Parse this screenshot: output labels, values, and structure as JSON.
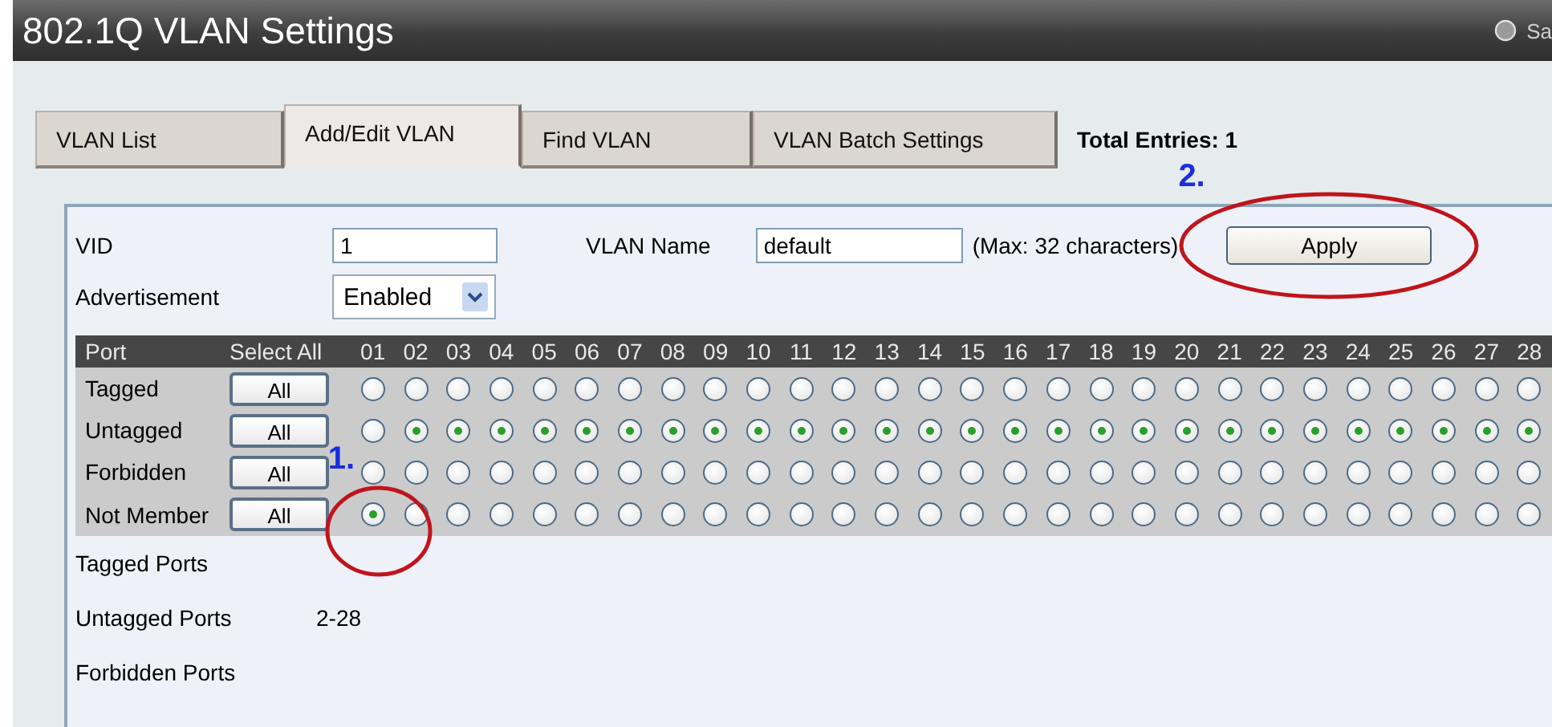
{
  "window": {
    "title": "802.1Q VLAN Settings",
    "corner_text": "Sa"
  },
  "tabs": [
    {
      "label": "VLAN List",
      "selected": false
    },
    {
      "label": "Add/Edit VLAN",
      "selected": true
    },
    {
      "label": "Find VLAN",
      "selected": false
    },
    {
      "label": "VLAN Batch Settings",
      "selected": false
    }
  ],
  "total_entries": "Total Entries: 1",
  "form": {
    "vid_label": "VID",
    "vid_value": "1",
    "name_label": "VLAN Name",
    "name_value": "default",
    "name_hint": "(Max: 32 characters)",
    "apply": "Apply",
    "advertisement_label": "Advertisement",
    "advertisement_value": "Enabled"
  },
  "ports": {
    "header": "Port",
    "select_all": "Select All",
    "numbers": [
      "01",
      "02",
      "03",
      "04",
      "05",
      "06",
      "07",
      "08",
      "09",
      "10",
      "11",
      "12",
      "13",
      "14",
      "15",
      "16",
      "17",
      "18",
      "19",
      "20",
      "21",
      "22",
      "23",
      "24",
      "25",
      "26",
      "27",
      "28"
    ],
    "rows": [
      {
        "label": "Tagged",
        "button": "All",
        "radios": [
          {
            "selected": false
          },
          {
            "selected": false
          },
          {
            "selected": false
          },
          {
            "selected": false
          },
          {
            "selected": false
          },
          {
            "selected": false
          },
          {
            "selected": false
          },
          {
            "selected": false
          },
          {
            "selected": false
          },
          {
            "selected": false
          },
          {
            "selected": false
          },
          {
            "selected": false
          },
          {
            "selected": false
          },
          {
            "selected": false
          },
          {
            "selected": false
          },
          {
            "selected": false
          },
          {
            "selected": false
          },
          {
            "selected": false
          },
          {
            "selected": false
          },
          {
            "selected": false
          },
          {
            "selected": false
          },
          {
            "selected": false
          },
          {
            "selected": false
          },
          {
            "selected": false
          },
          {
            "selected": false
          },
          {
            "selected": false
          },
          {
            "selected": false
          },
          {
            "selected": false
          }
        ]
      },
      {
        "label": "Untagged",
        "button": "All",
        "radios": [
          {
            "selected": false
          },
          {
            "selected": true
          },
          {
            "selected": true
          },
          {
            "selected": true
          },
          {
            "selected": true
          },
          {
            "selected": true
          },
          {
            "selected": true
          },
          {
            "selected": true
          },
          {
            "selected": true
          },
          {
            "selected": true
          },
          {
            "selected": true
          },
          {
            "selected": true
          },
          {
            "selected": true
          },
          {
            "selected": true
          },
          {
            "selected": true
          },
          {
            "selected": true
          },
          {
            "selected": true
          },
          {
            "selected": true
          },
          {
            "selected": true
          },
          {
            "selected": true
          },
          {
            "selected": true
          },
          {
            "selected": true
          },
          {
            "selected": true
          },
          {
            "selected": true
          },
          {
            "selected": true
          },
          {
            "selected": true
          },
          {
            "selected": true
          },
          {
            "selected": true
          }
        ]
      },
      {
        "label": "Forbidden",
        "button": "All",
        "radios": [
          {
            "selected": false
          },
          {
            "selected": false
          },
          {
            "selected": false
          },
          {
            "selected": false
          },
          {
            "selected": false
          },
          {
            "selected": false
          },
          {
            "selected": false
          },
          {
            "selected": false
          },
          {
            "selected": false
          },
          {
            "selected": false
          },
          {
            "selected": false
          },
          {
            "selected": false
          },
          {
            "selected": false
          },
          {
            "selected": false
          },
          {
            "selected": false
          },
          {
            "selected": false
          },
          {
            "selected": false
          },
          {
            "selected": false
          },
          {
            "selected": false
          },
          {
            "selected": false
          },
          {
            "selected": false
          },
          {
            "selected": false
          },
          {
            "selected": false
          },
          {
            "selected": false
          },
          {
            "selected": false
          },
          {
            "selected": false
          },
          {
            "selected": false
          },
          {
            "selected": false
          }
        ]
      },
      {
        "label": "Not Member",
        "button": "All",
        "radios": [
          {
            "selected": true
          },
          {
            "selected": false
          },
          {
            "selected": false
          },
          {
            "selected": false
          },
          {
            "selected": false
          },
          {
            "selected": false
          },
          {
            "selected": false
          },
          {
            "selected": false
          },
          {
            "selected": false
          },
          {
            "selected": false
          },
          {
            "selected": false
          },
          {
            "selected": false
          },
          {
            "selected": false
          },
          {
            "selected": false
          },
          {
            "selected": false
          },
          {
            "selected": false
          },
          {
            "selected": false
          },
          {
            "selected": false
          },
          {
            "selected": false
          },
          {
            "selected": false
          },
          {
            "selected": false
          },
          {
            "selected": false
          },
          {
            "selected": false
          },
          {
            "selected": false
          },
          {
            "selected": false
          },
          {
            "selected": false
          },
          {
            "selected": false
          },
          {
            "selected": false
          }
        ]
      }
    ]
  },
  "summary": [
    {
      "label": "Tagged Ports"
    },
    {
      "label": "Untagged Ports",
      "value": "2-28"
    },
    {
      "label": "Forbidden Ports"
    }
  ],
  "annotations": [
    {
      "label": "1.",
      "kind": "port"
    },
    {
      "label": "2.",
      "kind": "apply"
    }
  ]
}
